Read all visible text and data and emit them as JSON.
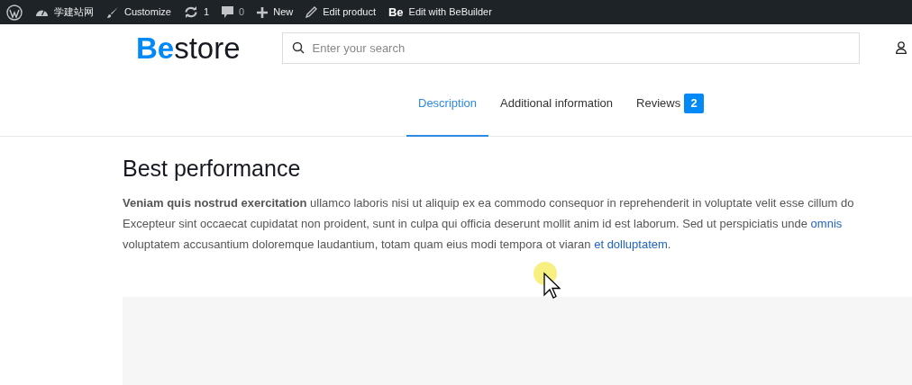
{
  "admin_bar": {
    "items": [
      {
        "kind": "wp"
      },
      {
        "kind": "site",
        "label": "学建站网"
      },
      {
        "kind": "brush",
        "label": "Customize"
      },
      {
        "kind": "updates",
        "label": "1"
      },
      {
        "kind": "comments",
        "label": "0"
      },
      {
        "kind": "new",
        "label": "New"
      },
      {
        "kind": "edit",
        "label": "Edit product"
      },
      {
        "kind": "be",
        "label": "Edit with BeBuilder",
        "icon_text": "Be"
      }
    ]
  },
  "header": {
    "logo": {
      "accent": "Be",
      "rest": "store"
    },
    "search": {
      "placeholder": "Enter your search"
    }
  },
  "tabs": [
    {
      "label": "Description",
      "selected": true
    },
    {
      "label": "Additional information",
      "selected": false
    },
    {
      "label": "Reviews",
      "selected": false,
      "badge": "2"
    }
  ],
  "content": {
    "heading": "Best performance",
    "lines": [
      [
        {
          "kind": "bold",
          "text": "Veniam quis nostrud exercitation"
        },
        {
          "kind": "plain",
          "text": " ullamco laboris nisi ut aliquip ex ea commodo consequor in reprehenderit in voluptate velit esse cillum do"
        }
      ],
      [
        {
          "kind": "plain",
          "text": "Excepteur sint occaecat cupidatat non proident, sunt in culpa qui officia deserunt mollit anim id est laborum. Sed ut perspiciatis unde "
        },
        {
          "kind": "link",
          "text": "omnis"
        }
      ],
      [
        {
          "kind": "plain",
          "text": "voluptatem accusantium doloremque laudantium, totam quam eius modi tempora ot viaran "
        },
        {
          "kind": "link",
          "text": "et dolluptatem"
        },
        {
          "kind": "plain",
          "text": "."
        }
      ]
    ]
  }
}
